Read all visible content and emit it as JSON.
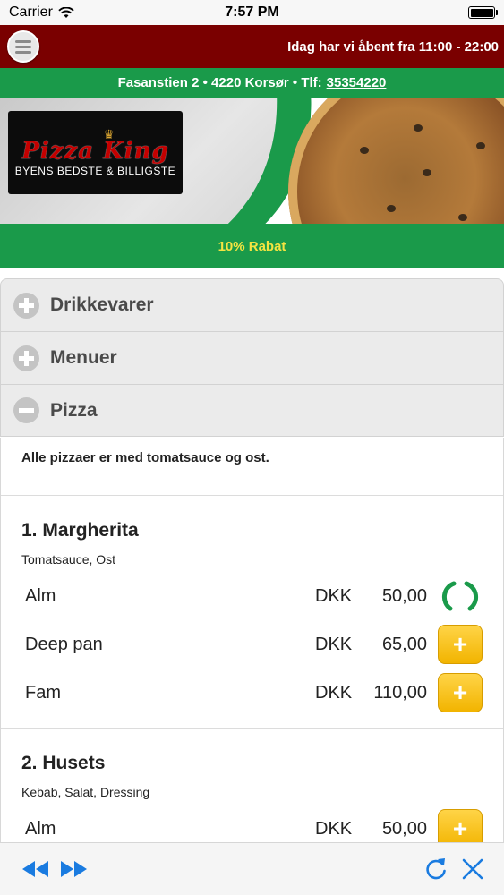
{
  "status_bar": {
    "carrier": "Carrier",
    "time": "7:57 PM"
  },
  "header": {
    "hours": "Idag har vi åbent fra 11:00 - 22:00"
  },
  "address": {
    "street": "Fasanstien 2 • 4220 Korsør • Tlf:",
    "phone": "35354220"
  },
  "banner": {
    "logo_brand": "Pizza King",
    "logo_tagline": "BYENS BEDSTE & BILLIGSTE",
    "discount": "10% Rabat"
  },
  "accordion": [
    {
      "label": "Drikkevarer",
      "state": "collapsed"
    },
    {
      "label": "Menuer",
      "state": "collapsed"
    },
    {
      "label": "Pizza",
      "state": "expanded"
    }
  ],
  "pizza_section": {
    "note": "Alle pizzaer er med tomatsauce og ost.",
    "items": [
      {
        "name": "1. Margherita",
        "desc": "Tomatsauce, Ost",
        "prices": [
          {
            "size": "Alm",
            "currency": "DKK",
            "amount": "50,00",
            "state": "loading"
          },
          {
            "size": "Deep pan",
            "currency": "DKK",
            "amount": "65,00",
            "state": "add"
          },
          {
            "size": "Fam",
            "currency": "DKK",
            "amount": "110,00",
            "state": "add"
          }
        ]
      },
      {
        "name": "2. Husets",
        "desc": "Kebab, Salat, Dressing",
        "prices": [
          {
            "size": "Alm",
            "currency": "DKK",
            "amount": "50,00",
            "state": "add"
          }
        ]
      }
    ]
  },
  "colors": {
    "header_red": "#7a0000",
    "green": "#1a9a4a",
    "discount_text": "#f4e441",
    "add_button": "#f2b400",
    "toolbar_blue": "#1a7be0"
  },
  "icons": {
    "menu": "hamburger-icon",
    "back": "rewind-icon",
    "forward": "fast-forward-icon",
    "reload": "reload-icon",
    "close": "close-icon"
  }
}
